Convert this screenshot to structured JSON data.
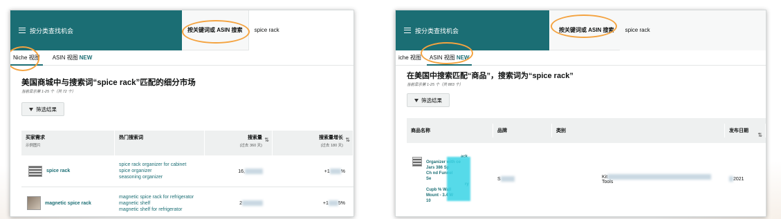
{
  "left_panel": {
    "brand": "按分类查找机会",
    "search_mode_label": "按关键词或 ASIN 搜索",
    "search_value": "spice rack",
    "tabs": [
      {
        "label": "Niche 视图",
        "badge": ""
      },
      {
        "label": "ASIN 视图",
        "badge": "NEW"
      }
    ],
    "heading": "美国商城中与搜索词“spice rack”匹配的细分市场",
    "subheading": "当前显示第 1-25 个（共 72 个）",
    "filter_label": "筛选结果",
    "columns": [
      {
        "label": "买家需求",
        "sub": "示例图片"
      },
      {
        "label": "热门搜索词",
        "sub": ""
      },
      {
        "label": "搜索量",
        "sub": "(过去 360 天)"
      },
      {
        "label": "搜索量增长",
        "sub": "(过去 180 天)"
      }
    ],
    "rows": [
      {
        "niche": "spice rack",
        "terms": [
          "spice rack organizer for cabinet",
          "spice organizer",
          "seasoning organizer"
        ],
        "volume": "16,",
        "growth": "+1",
        "growth_suffix": "%"
      },
      {
        "niche": "magnetic spice rack",
        "terms": [
          "magnetic spice rack for refrigerator",
          "magnetic shelf",
          "magnetic shelf for refrigerator"
        ],
        "volume": "2",
        "growth": "+1",
        "growth_suffix": "5%"
      }
    ]
  },
  "right_panel": {
    "brand": "按分类查找机会",
    "search_mode_label": "按关键词或 ASIN 搜索",
    "search_value": "spice rack",
    "tabs": [
      {
        "label": "iche 视图",
        "badge": ""
      },
      {
        "label": "ASIN 视图",
        "badge": "NEW"
      }
    ],
    "heading": "在美国中搜索匹配“商品”，搜索词为“spice rack”",
    "subheading": "当前显示第 1-25 个（共 883 个）",
    "filter_label": "筛选结果",
    "columns": [
      {
        "label": "商品名称"
      },
      {
        "label": "品牌"
      },
      {
        "label": "类别"
      },
      {
        "label": "发布日期"
      }
    ],
    "row": {
      "product_lines": [
        "ack",
        "Organizer with  ce",
        "Jars 386 Sp",
        "Ch  nd Funnel",
        "Se",
        "ry",
        "Cupb  % Wall",
        "Mount -  3.4 W",
        "10"
      ],
      "brand": "S",
      "category_start": "Kit",
      "category_end": "Tools",
      "date": "2021"
    }
  },
  "colors": {
    "brand_teal": "#1b6e74",
    "highlight_orange": "#f4a340"
  }
}
